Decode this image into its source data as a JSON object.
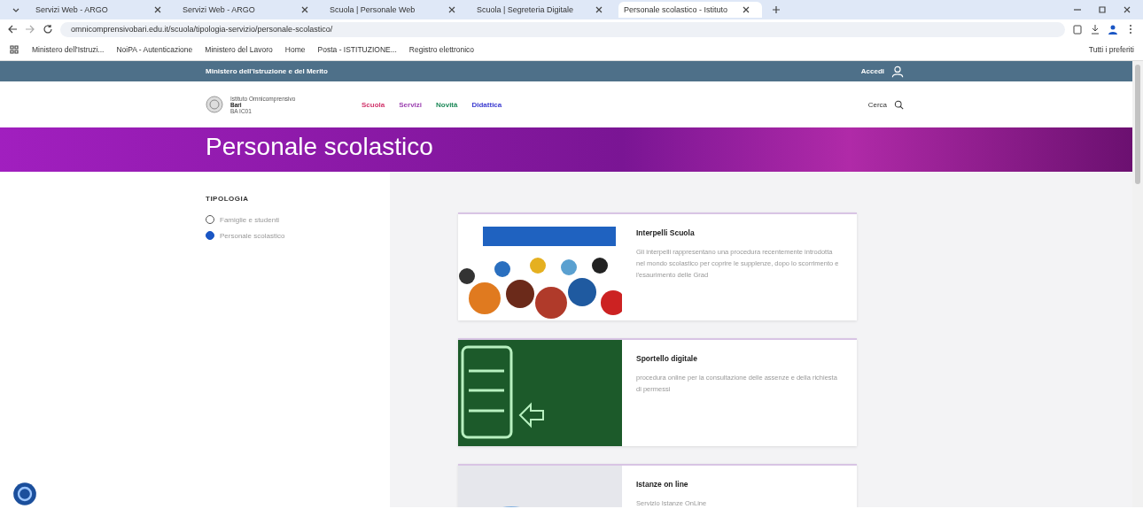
{
  "browser": {
    "tabs": [
      {
        "title": "Servizi Web - ARGO",
        "selected": false
      },
      {
        "title": "Servizi Web - ARGO",
        "selected": false
      },
      {
        "title": "Scuola | Personale Web",
        "selected": false
      },
      {
        "title": "Scuola | Segreteria Digitale",
        "selected": false
      },
      {
        "title": "Personale scolastico - Istituto",
        "selected": true
      }
    ],
    "url": "omnicomprensivobari.edu.it/scuola/tipologia-servizio/personale-scolastico/",
    "bookmarks": [
      "Ministero dell'Istruzi...",
      "NoiPA - Autenticazione",
      "Ministero del Lavoro",
      "Home",
      "Posta - ISTITUZIONE...",
      "Registro elettronico"
    ],
    "all_bookmarks": "Tutti i preferiti"
  },
  "topbar": {
    "ministry": "Ministero dell'Istruzione e del Merito",
    "login": "Accedi"
  },
  "header": {
    "school_type": "Istituto Omnicomprensivo",
    "school_name": "Bari",
    "school_city": "BA IC01",
    "nav": [
      {
        "label": "Scuola",
        "color": "#d1346b"
      },
      {
        "label": "Servizi",
        "color": "#9b3fb0"
      },
      {
        "label": "Novità",
        "color": "#1f8a5a"
      },
      {
        "label": "Didattica",
        "color": "#3a3ad0"
      }
    ],
    "search": "Cerca"
  },
  "hero": {
    "title": "Personale scolastico"
  },
  "filter": {
    "heading": "TIPOLOGIA",
    "options": [
      {
        "label": "Famiglie e studenti",
        "selected": false
      },
      {
        "label": "Personale scolastico",
        "selected": true
      }
    ]
  },
  "cards": [
    {
      "kind": "crowd",
      "title": "Interpelli Scuola",
      "text": "Gli interpelli rappresentano una procedura recentemente introdotta nel mondo scolastico per coprire le supplenze, dopo lo scorrimento e l'esaurimento delle Grad"
    },
    {
      "kind": "desk",
      "title": "Sportello digitale",
      "text": "procedura online per la consultazione delle assenze e della richiesta di permessi"
    },
    {
      "kind": "ring",
      "title": "Istanze on line",
      "text": "Servizio Istanze OnLine"
    }
  ]
}
